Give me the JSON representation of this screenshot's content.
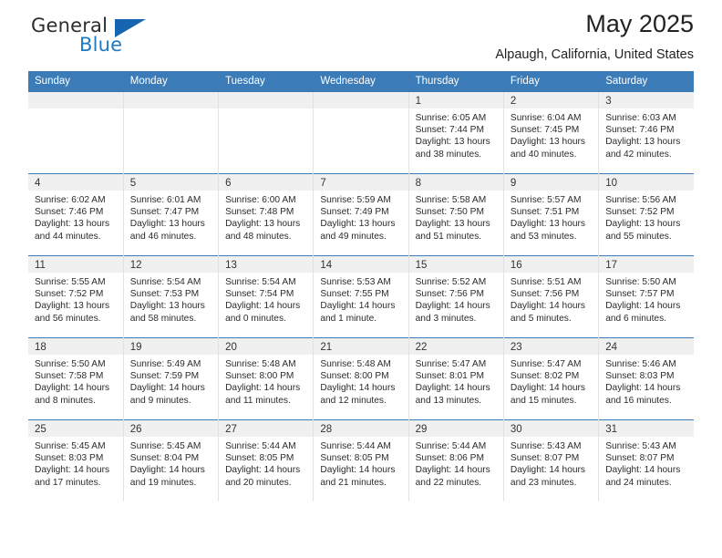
{
  "brand": {
    "name_top": "General",
    "name_bottom": "Blue",
    "accent_color": "#1565b0",
    "text_color": "#2d2d2d"
  },
  "header": {
    "title": "May 2025",
    "subtitle": "Alpaugh, California, United States"
  },
  "theme": {
    "header_bg": "#3b7cb8",
    "header_text": "#ffffff",
    "daynum_band_bg": "#f0f0f0",
    "cell_bg": "#ffffff",
    "grid_line": "#e2e2e2",
    "week_separator": "#3b7cb8"
  },
  "weekday_headers": [
    "Sunday",
    "Monday",
    "Tuesday",
    "Wednesday",
    "Thursday",
    "Friday",
    "Saturday"
  ],
  "weeks": [
    [
      {
        "day": "",
        "empty": true,
        "sunrise": "",
        "sunset": "",
        "daylight_line1": "",
        "daylight_line2": ""
      },
      {
        "day": "",
        "empty": true,
        "sunrise": "",
        "sunset": "",
        "daylight_line1": "",
        "daylight_line2": ""
      },
      {
        "day": "",
        "empty": true,
        "sunrise": "",
        "sunset": "",
        "daylight_line1": "",
        "daylight_line2": ""
      },
      {
        "day": "",
        "empty": true,
        "sunrise": "",
        "sunset": "",
        "daylight_line1": "",
        "daylight_line2": ""
      },
      {
        "day": "1",
        "empty": false,
        "sunrise": "Sunrise: 6:05 AM",
        "sunset": "Sunset: 7:44 PM",
        "daylight_line1": "Daylight: 13 hours",
        "daylight_line2": "and 38 minutes."
      },
      {
        "day": "2",
        "empty": false,
        "sunrise": "Sunrise: 6:04 AM",
        "sunset": "Sunset: 7:45 PM",
        "daylight_line1": "Daylight: 13 hours",
        "daylight_line2": "and 40 minutes."
      },
      {
        "day": "3",
        "empty": false,
        "sunrise": "Sunrise: 6:03 AM",
        "sunset": "Sunset: 7:46 PM",
        "daylight_line1": "Daylight: 13 hours",
        "daylight_line2": "and 42 minutes."
      }
    ],
    [
      {
        "day": "4",
        "empty": false,
        "sunrise": "Sunrise: 6:02 AM",
        "sunset": "Sunset: 7:46 PM",
        "daylight_line1": "Daylight: 13 hours",
        "daylight_line2": "and 44 minutes."
      },
      {
        "day": "5",
        "empty": false,
        "sunrise": "Sunrise: 6:01 AM",
        "sunset": "Sunset: 7:47 PM",
        "daylight_line1": "Daylight: 13 hours",
        "daylight_line2": "and 46 minutes."
      },
      {
        "day": "6",
        "empty": false,
        "sunrise": "Sunrise: 6:00 AM",
        "sunset": "Sunset: 7:48 PM",
        "daylight_line1": "Daylight: 13 hours",
        "daylight_line2": "and 48 minutes."
      },
      {
        "day": "7",
        "empty": false,
        "sunrise": "Sunrise: 5:59 AM",
        "sunset": "Sunset: 7:49 PM",
        "daylight_line1": "Daylight: 13 hours",
        "daylight_line2": "and 49 minutes."
      },
      {
        "day": "8",
        "empty": false,
        "sunrise": "Sunrise: 5:58 AM",
        "sunset": "Sunset: 7:50 PM",
        "daylight_line1": "Daylight: 13 hours",
        "daylight_line2": "and 51 minutes."
      },
      {
        "day": "9",
        "empty": false,
        "sunrise": "Sunrise: 5:57 AM",
        "sunset": "Sunset: 7:51 PM",
        "daylight_line1": "Daylight: 13 hours",
        "daylight_line2": "and 53 minutes."
      },
      {
        "day": "10",
        "empty": false,
        "sunrise": "Sunrise: 5:56 AM",
        "sunset": "Sunset: 7:52 PM",
        "daylight_line1": "Daylight: 13 hours",
        "daylight_line2": "and 55 minutes."
      }
    ],
    [
      {
        "day": "11",
        "empty": false,
        "sunrise": "Sunrise: 5:55 AM",
        "sunset": "Sunset: 7:52 PM",
        "daylight_line1": "Daylight: 13 hours",
        "daylight_line2": "and 56 minutes."
      },
      {
        "day": "12",
        "empty": false,
        "sunrise": "Sunrise: 5:54 AM",
        "sunset": "Sunset: 7:53 PM",
        "daylight_line1": "Daylight: 13 hours",
        "daylight_line2": "and 58 minutes."
      },
      {
        "day": "13",
        "empty": false,
        "sunrise": "Sunrise: 5:54 AM",
        "sunset": "Sunset: 7:54 PM",
        "daylight_line1": "Daylight: 14 hours",
        "daylight_line2": "and 0 minutes."
      },
      {
        "day": "14",
        "empty": false,
        "sunrise": "Sunrise: 5:53 AM",
        "sunset": "Sunset: 7:55 PM",
        "daylight_line1": "Daylight: 14 hours",
        "daylight_line2": "and 1 minute."
      },
      {
        "day": "15",
        "empty": false,
        "sunrise": "Sunrise: 5:52 AM",
        "sunset": "Sunset: 7:56 PM",
        "daylight_line1": "Daylight: 14 hours",
        "daylight_line2": "and 3 minutes."
      },
      {
        "day": "16",
        "empty": false,
        "sunrise": "Sunrise: 5:51 AM",
        "sunset": "Sunset: 7:56 PM",
        "daylight_line1": "Daylight: 14 hours",
        "daylight_line2": "and 5 minutes."
      },
      {
        "day": "17",
        "empty": false,
        "sunrise": "Sunrise: 5:50 AM",
        "sunset": "Sunset: 7:57 PM",
        "daylight_line1": "Daylight: 14 hours",
        "daylight_line2": "and 6 minutes."
      }
    ],
    [
      {
        "day": "18",
        "empty": false,
        "sunrise": "Sunrise: 5:50 AM",
        "sunset": "Sunset: 7:58 PM",
        "daylight_line1": "Daylight: 14 hours",
        "daylight_line2": "and 8 minutes."
      },
      {
        "day": "19",
        "empty": false,
        "sunrise": "Sunrise: 5:49 AM",
        "sunset": "Sunset: 7:59 PM",
        "daylight_line1": "Daylight: 14 hours",
        "daylight_line2": "and 9 minutes."
      },
      {
        "day": "20",
        "empty": false,
        "sunrise": "Sunrise: 5:48 AM",
        "sunset": "Sunset: 8:00 PM",
        "daylight_line1": "Daylight: 14 hours",
        "daylight_line2": "and 11 minutes."
      },
      {
        "day": "21",
        "empty": false,
        "sunrise": "Sunrise: 5:48 AM",
        "sunset": "Sunset: 8:00 PM",
        "daylight_line1": "Daylight: 14 hours",
        "daylight_line2": "and 12 minutes."
      },
      {
        "day": "22",
        "empty": false,
        "sunrise": "Sunrise: 5:47 AM",
        "sunset": "Sunset: 8:01 PM",
        "daylight_line1": "Daylight: 14 hours",
        "daylight_line2": "and 13 minutes."
      },
      {
        "day": "23",
        "empty": false,
        "sunrise": "Sunrise: 5:47 AM",
        "sunset": "Sunset: 8:02 PM",
        "daylight_line1": "Daylight: 14 hours",
        "daylight_line2": "and 15 minutes."
      },
      {
        "day": "24",
        "empty": false,
        "sunrise": "Sunrise: 5:46 AM",
        "sunset": "Sunset: 8:03 PM",
        "daylight_line1": "Daylight: 14 hours",
        "daylight_line2": "and 16 minutes."
      }
    ],
    [
      {
        "day": "25",
        "empty": false,
        "sunrise": "Sunrise: 5:45 AM",
        "sunset": "Sunset: 8:03 PM",
        "daylight_line1": "Daylight: 14 hours",
        "daylight_line2": "and 17 minutes."
      },
      {
        "day": "26",
        "empty": false,
        "sunrise": "Sunrise: 5:45 AM",
        "sunset": "Sunset: 8:04 PM",
        "daylight_line1": "Daylight: 14 hours",
        "daylight_line2": "and 19 minutes."
      },
      {
        "day": "27",
        "empty": false,
        "sunrise": "Sunrise: 5:44 AM",
        "sunset": "Sunset: 8:05 PM",
        "daylight_line1": "Daylight: 14 hours",
        "daylight_line2": "and 20 minutes."
      },
      {
        "day": "28",
        "empty": false,
        "sunrise": "Sunrise: 5:44 AM",
        "sunset": "Sunset: 8:05 PM",
        "daylight_line1": "Daylight: 14 hours",
        "daylight_line2": "and 21 minutes."
      },
      {
        "day": "29",
        "empty": false,
        "sunrise": "Sunrise: 5:44 AM",
        "sunset": "Sunset: 8:06 PM",
        "daylight_line1": "Daylight: 14 hours",
        "daylight_line2": "and 22 minutes."
      },
      {
        "day": "30",
        "empty": false,
        "sunrise": "Sunrise: 5:43 AM",
        "sunset": "Sunset: 8:07 PM",
        "daylight_line1": "Daylight: 14 hours",
        "daylight_line2": "and 23 minutes."
      },
      {
        "day": "31",
        "empty": false,
        "sunrise": "Sunrise: 5:43 AM",
        "sunset": "Sunset: 8:07 PM",
        "daylight_line1": "Daylight: 14 hours",
        "daylight_line2": "and 24 minutes."
      }
    ]
  ]
}
